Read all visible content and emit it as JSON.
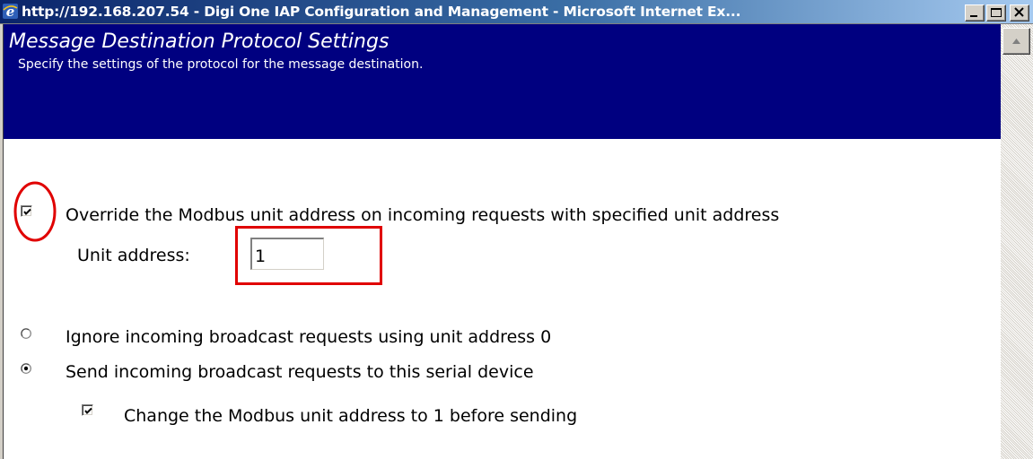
{
  "window": {
    "title": "http://192.168.207.54 - Digi One IAP Configuration and Management - Microsoft Internet Ex...",
    "buttons": [
      "minimize",
      "maximize",
      "close"
    ]
  },
  "header": {
    "title": "Message Destination Protocol Settings",
    "subtitle": "Specify the settings of the protocol for the message destination.",
    "background_color": "#000080"
  },
  "form": {
    "override_checkbox": {
      "label": "Override the Modbus unit address on incoming requests with specified unit address",
      "checked": true
    },
    "unit_address": {
      "label": "Unit address:",
      "value": "1"
    },
    "broadcast_options": [
      {
        "label": "Ignore incoming broadcast requests using unit address 0",
        "selected": false
      },
      {
        "label": "Send incoming broadcast requests to this serial device",
        "selected": true
      }
    ],
    "change_address_checkbox": {
      "label": "Change the Modbus unit address to 1 before sending",
      "checked": true
    }
  },
  "annotations": {
    "highlight_color": "#e00000"
  },
  "icons": {
    "title": "ie-icon",
    "scroll_up": "arrow-up-icon"
  }
}
